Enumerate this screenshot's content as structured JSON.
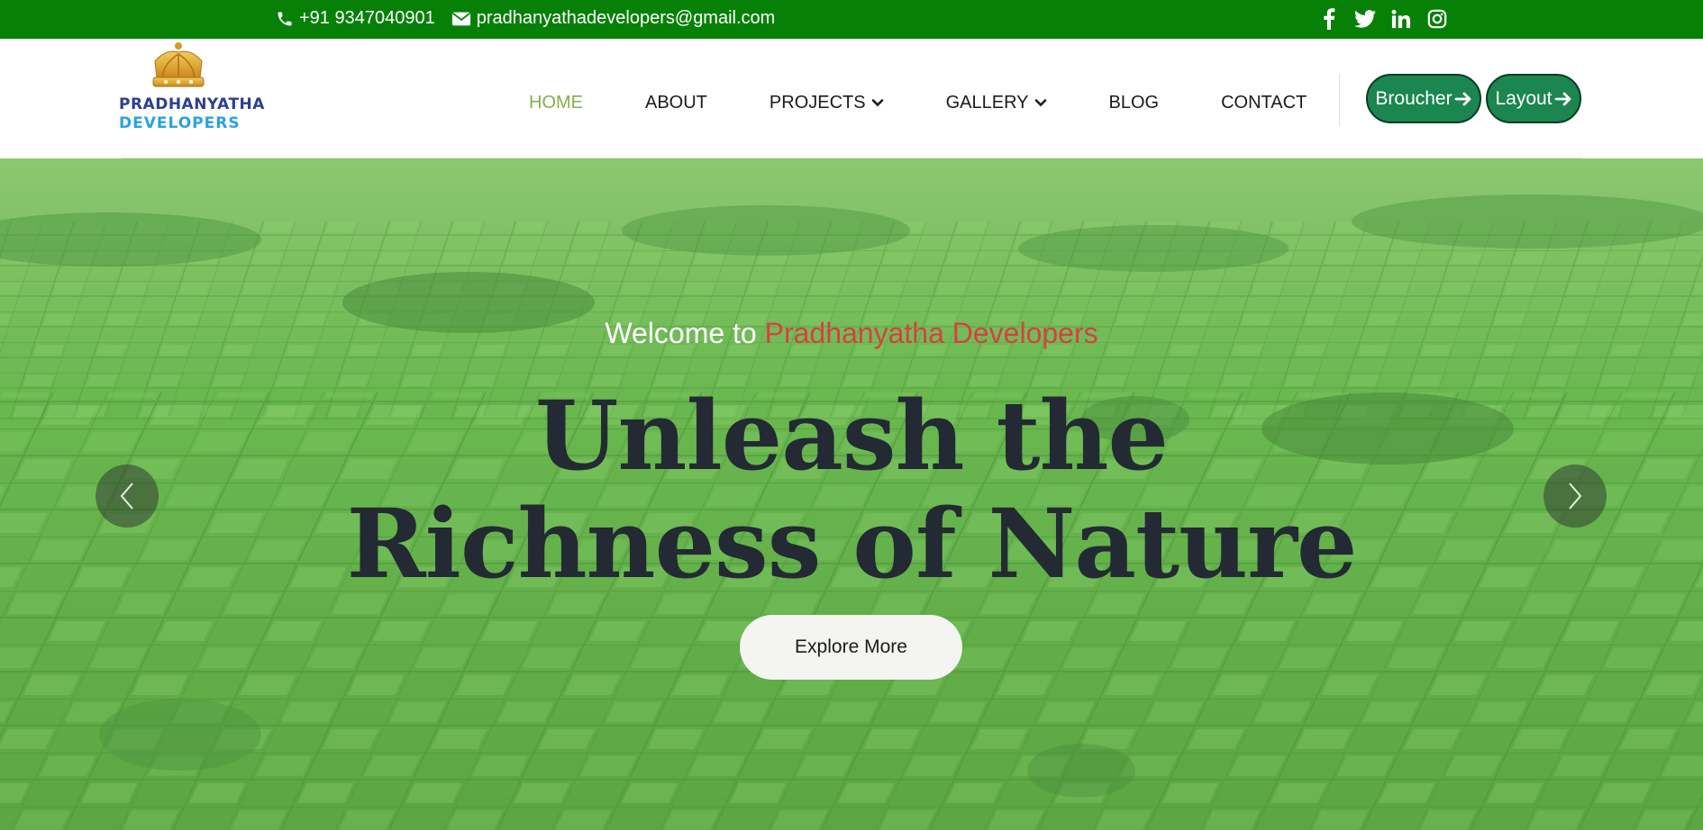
{
  "topbar": {
    "phone": "+91 9347040901",
    "email": "pradhanyathadevelopers@gmail.com",
    "social_icons": [
      "facebook-icon",
      "twitter-icon",
      "linkedin-icon",
      "instagram-icon"
    ]
  },
  "logo": {
    "line1": "PRADHANYATHA",
    "line2": "DEVELOPERS"
  },
  "nav": {
    "items": [
      {
        "label": "HOME",
        "active": true
      },
      {
        "label": "ABOUT"
      },
      {
        "label": "PROJECTS",
        "dropdown": true
      },
      {
        "label": "GALLERY",
        "dropdown": true
      },
      {
        "label": "BLOG"
      },
      {
        "label": "CONTACT"
      }
    ]
  },
  "buttons": {
    "brochure": "Broucher",
    "layout": "Layout"
  },
  "hero": {
    "welcome_prefix": "Welcome to",
    "welcome_brand": "Pradhanyatha Developers",
    "headline_line1": "Unleash the",
    "headline_line2": "Richness of Nature",
    "cta": "Explore More"
  },
  "colors": {
    "topbar": "#078007",
    "active_nav": "#86ae4d",
    "pill": "#1b8650",
    "brand_red": "#d94040",
    "headline": "#232a33"
  }
}
